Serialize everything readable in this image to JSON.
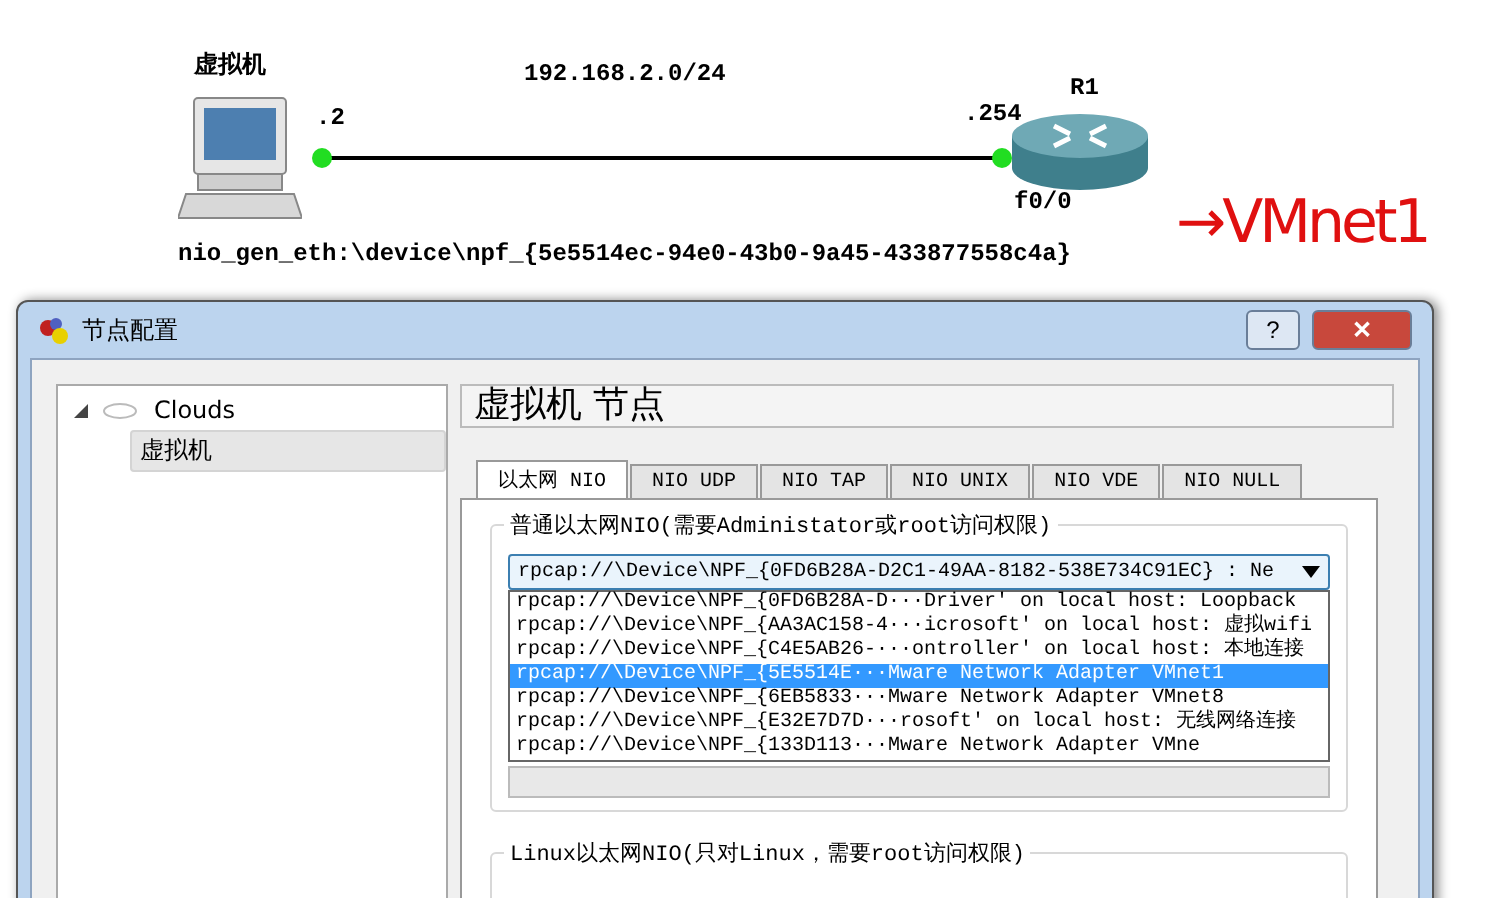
{
  "topology": {
    "host_label": "虚拟机",
    "host_port": ".2",
    "subnet": "192.168.2.0/24",
    "router_port": ".254",
    "router_label": "R1",
    "router_interface": "f0/0",
    "nio_label": "nio_gen_eth:\\device\\npf_{5e5514ec-94e0-43b0-9a45-433877558c4a}",
    "annotation": "→VMnet1"
  },
  "window": {
    "title": "节点配置",
    "help": "?",
    "close": "✕"
  },
  "tree": [
    {
      "label": "Clouds",
      "expanded": true,
      "selected": false,
      "children": [
        {
          "label": "虚拟机",
          "selected": true
        }
      ]
    }
  ],
  "header": "虚拟机  节点",
  "tabs": [
    {
      "label": "以太网 NIO",
      "selected": true
    },
    {
      "label": "NIO UDP",
      "selected": false
    },
    {
      "label": "NIO TAP",
      "selected": false
    },
    {
      "label": "NIO UNIX",
      "selected": false
    },
    {
      "label": "NIO VDE",
      "selected": false
    },
    {
      "label": "NIO NULL",
      "selected": false
    }
  ],
  "generic_group": {
    "title": "普通以太网NIO(需要Administator或root访问权限)",
    "combo_value": "rpcap://\\Device\\NPF_{0FD6B28A-D2C1-49AA-8182-538E734C91EC} : Ne",
    "options": [
      {
        "label": "rpcap://\\Device\\NPF_{0FD6B28A-D···Driver' on local host: Loopback",
        "selected": false
      },
      {
        "label": "rpcap://\\Device\\NPF_{AA3AC158-4···icrosoft' on local host: 虚拟wifi",
        "selected": false
      },
      {
        "label": "rpcap://\\Device\\NPF_{C4E5AB26-···ontroller' on local host: 本地连接",
        "selected": false
      },
      {
        "label": "rpcap://\\Device\\NPF_{5E5514E···Mware Network Adapter VMnet1",
        "selected": true
      },
      {
        "label": "rpcap://\\Device\\NPF_{6EB5833···Mware Network Adapter VMnet8",
        "selected": false
      },
      {
        "label": "rpcap://\\Device\\NPF_{E32E7D7D···rosoft' on local host: 无线网络连接",
        "selected": false
      },
      {
        "label": "rpcap://\\Device\\NPF_{133D113···Mware Network Adapter VMne",
        "selected": false
      }
    ]
  },
  "linux_group": {
    "title": "Linux以太网NIO(只对Linux，需要root访问权限)"
  }
}
